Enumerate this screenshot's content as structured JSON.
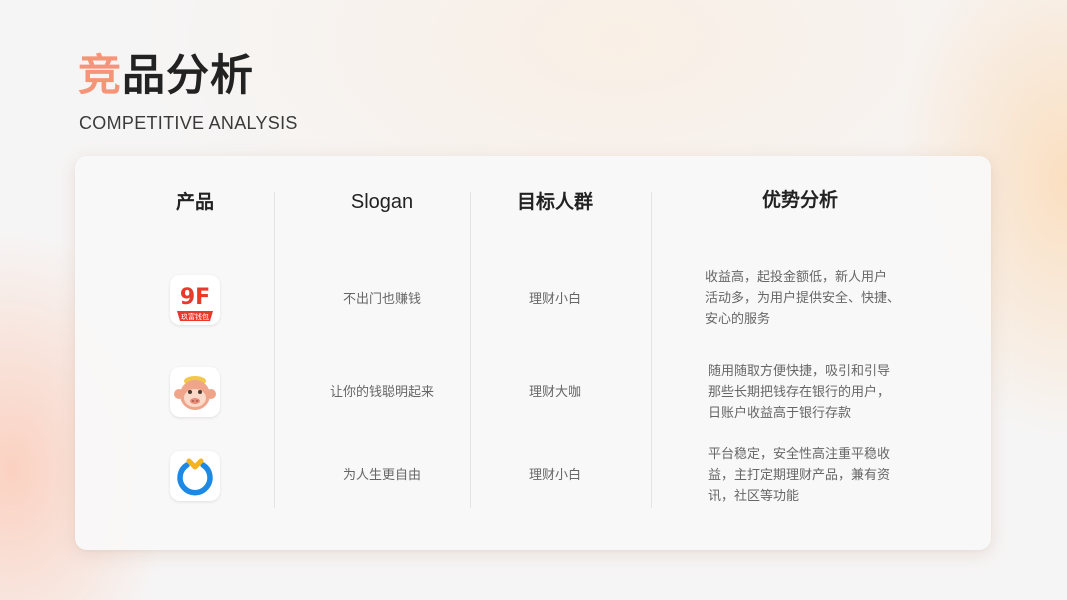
{
  "page": {
    "title_accent": "竞",
    "title_rest": "品分析",
    "subtitle": "COMPETITIVE ANALYSIS"
  },
  "table": {
    "headers": {
      "product": "产品",
      "slogan": "Slogan",
      "target": "目标人群",
      "advantage": "优势分析"
    },
    "rows": [
      {
        "logo_icon": "jiufu-wallet-logo-icon",
        "logo_text": "玖富钱包",
        "slogan": "不出门也赚钱",
        "target": "理财小白",
        "advantage_lines": [
          "收益高，起投金额低，新人用户",
          "活动多，为用户提供安全、快捷、",
          "安心的服务"
        ]
      },
      {
        "logo_icon": "monkey-face-logo-icon",
        "slogan": "让你的钱聪明起来",
        "target": "理财大咖",
        "advantage_lines": [
          "随用随取方便快捷，吸引和引导",
          "那些长期把钱存在银行的用户，",
          "日账户收益高于银行存款"
        ]
      },
      {
        "logo_icon": "blue-ring-logo-icon",
        "slogan": "为人生更自由",
        "target": "理财小白",
        "advantage_lines": [
          "平台稳定，安全性高注重平稳收",
          "益，主打定期理财产品，兼有资",
          "讯，社区等功能"
        ]
      }
    ]
  },
  "colors": {
    "accent": "#f69478",
    "title": "#222222",
    "body_text": "#666666",
    "jiufu_red": "#e8392b",
    "ring_blue": "#1e88e5",
    "ring_gold": "#f5b323"
  }
}
